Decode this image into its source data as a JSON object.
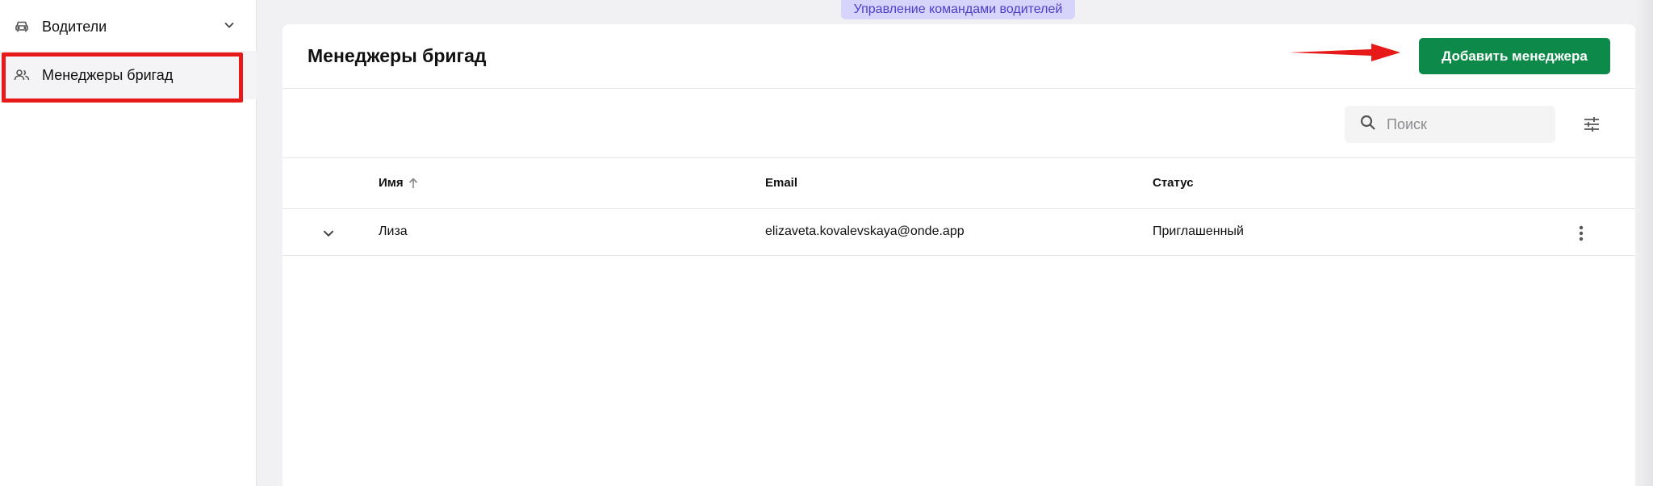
{
  "banner": {
    "label": "Управление командами водителей"
  },
  "sidebar": {
    "items": [
      {
        "label": "Водители",
        "icon": "car-icon",
        "expandable": true
      },
      {
        "label": "Менеджеры бригад",
        "icon": "users-icon",
        "active": true
      }
    ]
  },
  "header": {
    "title": "Менеджеры бригад",
    "add_button_label": "Добавить менеджера"
  },
  "toolbar": {
    "search_placeholder": "Поиск",
    "filter_icon": "sliders-icon"
  },
  "table": {
    "columns": [
      {
        "label": "Имя",
        "sorted": "asc"
      },
      {
        "label": "Email"
      },
      {
        "label": "Статус"
      }
    ],
    "rows": [
      {
        "name": "Лиза",
        "email": "elizaveta.kovalevskaya@onde.app",
        "status": "Приглашенный"
      }
    ]
  },
  "colors": {
    "accent": "#0d8a4a",
    "highlight": "#e81919",
    "banner_bg": "#d7d4fb",
    "banner_text": "#4a3fc7"
  }
}
